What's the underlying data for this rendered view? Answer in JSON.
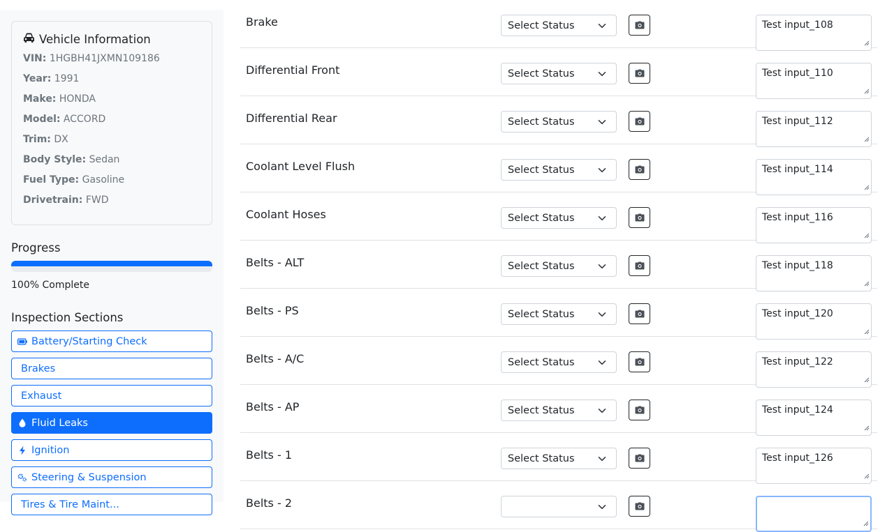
{
  "vehicle": {
    "title": "Vehicle Information",
    "vin_label": "VIN:",
    "vin": "1HGBH41JXMN109186",
    "year_label": "Year:",
    "year": "1991",
    "make_label": "Make:",
    "make": "HONDA",
    "model_label": "Model:",
    "model": "ACCORD",
    "trim_label": "Trim:",
    "trim": "DX",
    "body_label": "Body Style:",
    "body": "Sedan",
    "fuel_label": "Fuel Type:",
    "fuel": "Gasoline",
    "drive_label": "Drivetrain:",
    "drive": "FWD"
  },
  "progress": {
    "label": "Progress",
    "value_percent": 100,
    "text": "100% Complete",
    "color": "#0d6efd"
  },
  "sections": {
    "label": "Inspection Sections",
    "items": [
      {
        "label": "Battery/Starting Check",
        "icon": "battery-icon",
        "active": false
      },
      {
        "label": "Brakes",
        "icon": "",
        "active": false
      },
      {
        "label": "Exhaust",
        "icon": "",
        "active": false
      },
      {
        "label": "Fluid Leaks",
        "icon": "droplet-icon",
        "active": true
      },
      {
        "label": "Ignition",
        "icon": "lightning-icon",
        "active": false
      },
      {
        "label": "Steering & Suspension",
        "icon": "gears-icon",
        "active": false
      },
      {
        "label": "Tires & Tire Maint...",
        "icon": "",
        "active": false
      }
    ]
  },
  "items": [
    {
      "name": "Brake",
      "status": "Select Status",
      "note": "Test input_108"
    },
    {
      "name": "Differential Front",
      "status": "Select Status",
      "note": "Test input_110"
    },
    {
      "name": "Differential Rear",
      "status": "Select Status",
      "note": "Test input_112"
    },
    {
      "name": "Coolant Level Flush",
      "status": "Select Status",
      "note": "Test input_114"
    },
    {
      "name": "Coolant Hoses",
      "status": "Select Status",
      "note": "Test input_116"
    },
    {
      "name": "Belts - ALT",
      "status": "Select Status",
      "note": "Test input_118"
    },
    {
      "name": "Belts - PS",
      "status": "Select Status",
      "note": "Test input_120"
    },
    {
      "name": "Belts - A/C",
      "status": "Select Status",
      "note": "Test input_122"
    },
    {
      "name": "Belts - AP",
      "status": "Select Status",
      "note": "Test input_124"
    },
    {
      "name": "Belts - 1",
      "status": "Select Status",
      "note": "Test input_126"
    },
    {
      "name": "Belts - 2",
      "status": "",
      "note": ""
    }
  ],
  "colors": {
    "primary": "#0d6efd",
    "border": "#dee2e6",
    "muted": "#6c757d"
  }
}
